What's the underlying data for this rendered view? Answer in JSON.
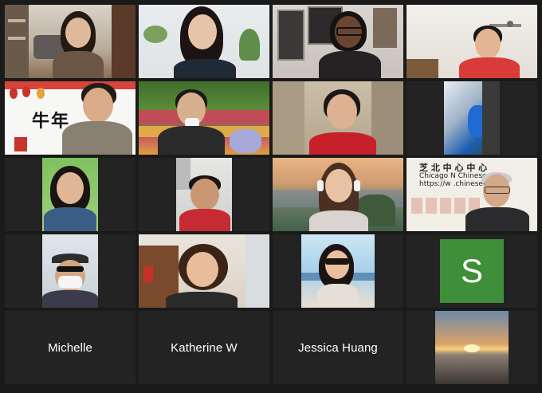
{
  "participants": [
    {
      "name": "",
      "video": "woman-indoor-bookshelf"
    },
    {
      "name": "",
      "video": "woman-plants"
    },
    {
      "name": "",
      "video": "woman-glasses-wall-art"
    },
    {
      "name": "",
      "video": "man-ceiling-fan"
    },
    {
      "name": "",
      "video": "man-new-year-background"
    },
    {
      "name": "",
      "video": "woman-tulip-garden"
    },
    {
      "name": "",
      "video": "woman-red-sweater"
    },
    {
      "name": "",
      "video": "blurred-hand"
    },
    {
      "name": "",
      "video": "woman-green-wall"
    },
    {
      "name": "",
      "video": "man-red-shirt"
    },
    {
      "name": "",
      "video": "woman-headphones-lake"
    },
    {
      "name": "",
      "video": "man-chinese-center-background"
    },
    {
      "name": "",
      "video": "man-mask-cap"
    },
    {
      "name": "",
      "video": "woman-kitchen"
    },
    {
      "name": "",
      "video": "girl-beach-photo"
    },
    {
      "name": "",
      "video": "avatar",
      "avatar_letter": "S",
      "avatar_color": "#3e8e3a"
    },
    {
      "name": "Michelle",
      "video": "none"
    },
    {
      "name": "Katherine W",
      "video": "none"
    },
    {
      "name": "Jessica Huang",
      "video": "none"
    },
    {
      "name": "",
      "video": "sunset-photo"
    }
  ],
  "backgrounds": {
    "new_year_char_1": "牛",
    "new_year_char_2": "年",
    "center_sign_cn": "芝 北 中 心 中 心",
    "center_sign_en": "Chicago N     Chinese Ce",
    "center_sign_url": "https://w     .chinesecen"
  },
  "colors": {
    "grid_bg": "#1a1a1a",
    "tile_bg": "#232323",
    "avatar_green": "#3e8e3a",
    "name_text": "#ffffff"
  }
}
